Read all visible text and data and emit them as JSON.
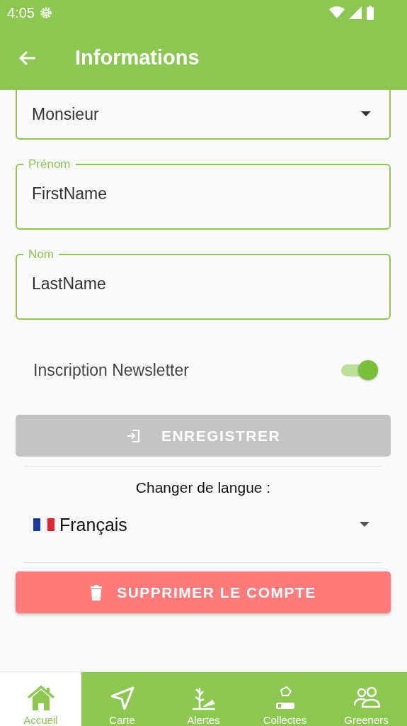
{
  "status_bar": {
    "time": "4:05"
  },
  "app_bar": {
    "title": "Informations"
  },
  "civility": {
    "value": "Monsieur"
  },
  "fields": [
    {
      "label": "Prénom",
      "value": "FirstName"
    },
    {
      "label": "Nom",
      "value": "LastName"
    }
  ],
  "newsletter": {
    "label": "Inscription Newsletter",
    "on": true
  },
  "save_button": {
    "label": "ENREGISTRER",
    "disabled": true
  },
  "language": {
    "heading": "Changer de langue :",
    "value": "Français"
  },
  "delete_button": {
    "label": "SUPPRIMER LE COMPTE"
  },
  "bottom_nav": [
    {
      "label": "Accueil",
      "kind": "home",
      "selected": true
    },
    {
      "label": "Carte",
      "kind": "map",
      "selected": false
    },
    {
      "label": "Alertes",
      "kind": "alerts",
      "selected": false
    },
    {
      "label": "Collectes",
      "kind": "collect",
      "selected": false
    },
    {
      "label": "Greeners",
      "kind": "people",
      "selected": false
    }
  ]
}
